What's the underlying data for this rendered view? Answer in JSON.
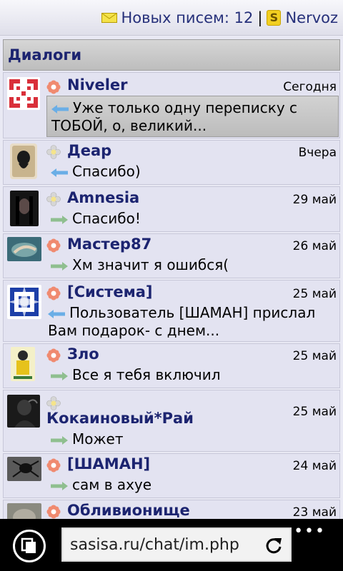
{
  "topbar": {
    "new_mail_label": "Новых писем: 12",
    "separator": "|",
    "user_name": "Nervoz"
  },
  "section": {
    "title": "Диалоги"
  },
  "dialogs": [
    {
      "name": "Niveler",
      "date": "Сегодня",
      "direction": "incoming",
      "online": true,
      "preview_line1": "Уже только одну переписку с",
      "preview_line2": "ТОБОЙ, о, великий...",
      "avatar": "red-pattern-avatar"
    },
    {
      "name": "Деар",
      "date": "Вчера",
      "direction": "incoming",
      "online": false,
      "preview_line1": "Спасибо)",
      "avatar": "dark-figure-avatar"
    },
    {
      "name": "Amnesia",
      "date": "29 май",
      "direction": "outgoing",
      "online": false,
      "preview_line1": "Спасибо!",
      "avatar": "dark-hair-avatar"
    },
    {
      "name": "Мастер87",
      "date": "26 май",
      "direction": "outgoing",
      "online": true,
      "preview_line1": "Хм значит я ошибся(",
      "avatar": "hand-photo-avatar"
    },
    {
      "name": "[Система]",
      "date": "25 май",
      "direction": "incoming",
      "online": true,
      "preview_line1": "Пользователь [ШАМАН] прислал",
      "preview_line2": "Вам подарок- с днем...",
      "avatar": "blue-pattern-avatar"
    },
    {
      "name": "Зло",
      "date": "25 май",
      "direction": "outgoing",
      "online": true,
      "preview_line1": "Все я тебя включил",
      "avatar": "yellow-figure-avatar"
    },
    {
      "name": "Кокаиновый*Рай",
      "date": "25 май",
      "direction": "outgoing",
      "online": false,
      "preview_line1": "Может",
      "avatar": "smoke-avatar"
    },
    {
      "name": "[ШАМАН]",
      "date": "24 май",
      "direction": "outgoing",
      "online": true,
      "preview_line1": "сам в ахуе",
      "avatar": "spider-avatar"
    },
    {
      "name": "Обливионище",
      "date": "23 май",
      "direction": "outgoing",
      "online": true,
      "preview_line1": "",
      "avatar": "elephant-avatar"
    }
  ],
  "browser": {
    "url": "sasisa.ru/chat/im.php",
    "more_label": "•••"
  },
  "colors": {
    "name_blue": "#1c2470",
    "row_bg": "#e3e3f1",
    "incoming_arrow": "#5aa0e0",
    "outgoing_arrow": "#8cc08c",
    "online_flower": "#f07a5a",
    "offline_flower": "#d0d0d0"
  }
}
